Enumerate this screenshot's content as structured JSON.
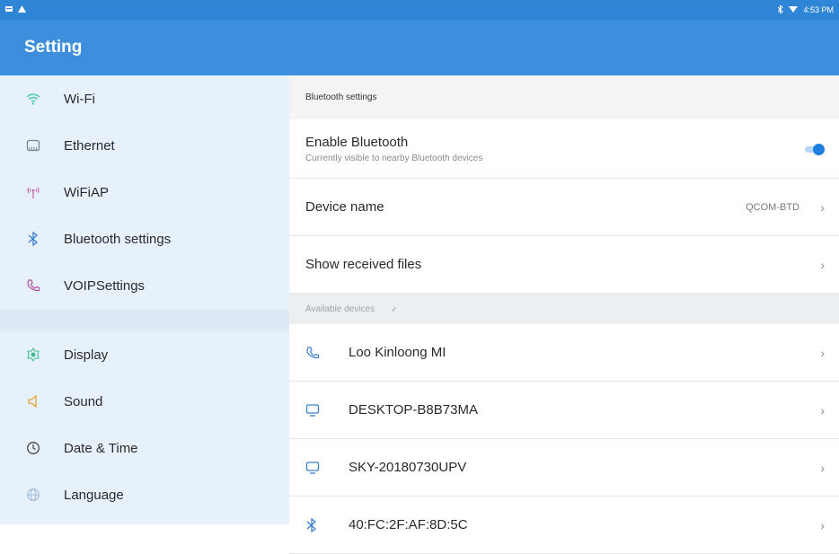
{
  "status_bar": {
    "time": "4:53 PM",
    "left_icons": [
      "notification-icon",
      "warning-icon"
    ],
    "right_icons": [
      "bluetooth-icon",
      "wifi-icon"
    ]
  },
  "app_bar": {
    "title": "Setting"
  },
  "sidebar": {
    "items": [
      {
        "label": "Wi-Fi",
        "icon": "wifi-icon"
      },
      {
        "label": "Ethernet",
        "icon": "ethernet-icon"
      },
      {
        "label": "WiFiAP",
        "icon": "hotspot-icon"
      },
      {
        "label": "Bluetooth settings",
        "icon": "bluetooth-icon"
      },
      {
        "label": "VOIPSettings",
        "icon": "phone-icon"
      },
      {
        "label": "Display",
        "icon": "display-icon"
      },
      {
        "label": "Sound",
        "icon": "sound-icon"
      },
      {
        "label": "Date & Time",
        "icon": "clock-icon"
      },
      {
        "label": "Language",
        "icon": "globe-icon"
      }
    ]
  },
  "main": {
    "section_title": "Bluetooth settings",
    "enable": {
      "title": "Enable Bluetooth",
      "subtitle": "Currently visible to nearby Bluetooth devices",
      "enabled": true
    },
    "device_name": {
      "title": "Device name",
      "value": "QCOM-BTD"
    },
    "received_files": {
      "title": "Show received files"
    },
    "available_header": "Available devices",
    "devices": [
      {
        "name": "Loo Kinloong MI",
        "icon": "phone-icon"
      },
      {
        "name": "DESKTOP-B8B73MA",
        "icon": "computer-icon"
      },
      {
        "name": "SKY-20180730UPV",
        "icon": "computer-icon"
      },
      {
        "name": "40:FC:2F:AF:8D:5C",
        "icon": "bluetooth-icon"
      }
    ],
    "chevron": "›"
  },
  "colors": {
    "status_bar": "#2f86d6",
    "app_bar": "#3d8fdd",
    "sidebar_bg": "#e7f1fb",
    "accent": "#1e7fe0"
  }
}
